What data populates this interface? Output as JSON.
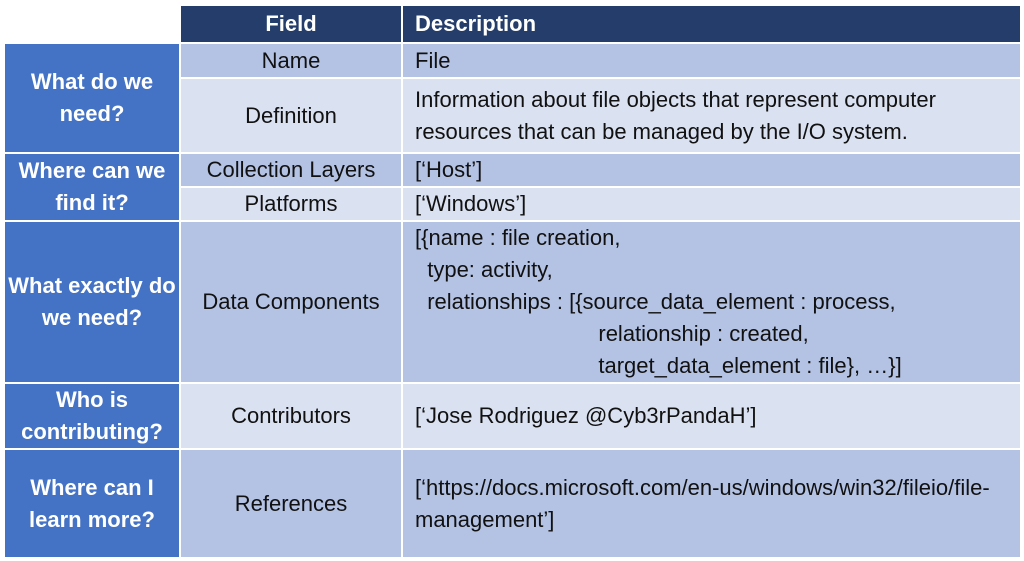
{
  "header": {
    "field": "Field",
    "description": "Description"
  },
  "questions": {
    "what_do_we_need": "What do we need?",
    "where_can_we_find_it": "Where can we find it?",
    "what_exactly": "What exactly do we need?",
    "who_contributing": "Who is contributing?",
    "where_learn_more": "Where can I learn more?"
  },
  "rows": {
    "name": {
      "field": "Name",
      "value": "File"
    },
    "definition": {
      "field": "Definition",
      "value": "Information about file objects that represent computer resources that can be managed by the I/O system."
    },
    "collection_layers": {
      "field": "Collection Layers",
      "value": "[‘Host’]"
    },
    "platforms": {
      "field": "Platforms",
      "value": "[‘Windows’]"
    },
    "data_components": {
      "field": "Data Components",
      "lines": [
        "[{name : file creation,",
        "  type: activity,",
        "  relationships : [{source_data_element : process,",
        "                              relationship : created,",
        "                              target_data_element : file}, …}]"
      ]
    },
    "contributors": {
      "field": "Contributors",
      "value": "[‘Jose Rodriguez @Cyb3rPandaH’]"
    },
    "references": {
      "field": "References",
      "value": "[‘https://docs.microsoft.com/en-us/windows/win32/fileio/file-management’]"
    }
  }
}
